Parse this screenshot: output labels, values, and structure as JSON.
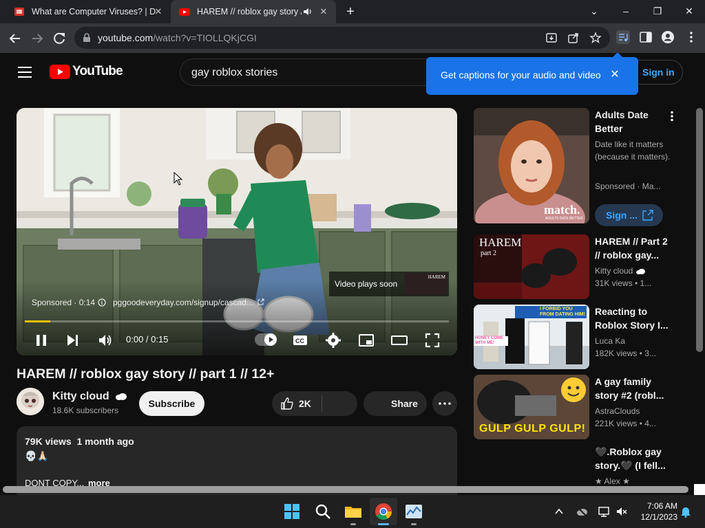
{
  "browser": {
    "tabs": [
      {
        "title": "What are Computer Viruses? | D",
        "active": false
      },
      {
        "title": "HAREM // roblox gay story /",
        "active": true
      }
    ],
    "url_host": "youtube.com",
    "url_path": "/watch?v=TIOLLQKjCGI"
  },
  "header": {
    "logo_text": "YouTube",
    "search_value": "gay roblox stories",
    "signin_label": "Sign in"
  },
  "tooltip": {
    "text": "Get captions for your audio and video"
  },
  "player": {
    "sponsored_label": "Sponsored · 0:14",
    "ad_url": "pggoodeveryday.com/signup/cascad...",
    "video_plays_soon": "Video plays soon",
    "up_next_thumb_text": "HAREM",
    "time": "0:00 / 0:15",
    "progress": 0.06
  },
  "video": {
    "title": "HAREM // roblox gay story // part 1 // 12+",
    "channel": "Kitty cloud",
    "subscribers": "18.6K subscribers",
    "subscribe_label": "Subscribe",
    "likes": "2K",
    "share_label": "Share",
    "views_date": "79K views  1 month ago",
    "desc_emoji": "💀🙏🏻",
    "desc_snippet": "DONT COPY...",
    "more_label": "more"
  },
  "sidebar": [
    {
      "title": "Adults Date Better",
      "line2": "Date like it matters (because it matters).",
      "meta": "Sponsored · Ma...",
      "cta": "Sign ...",
      "thumb_text": "match.",
      "thumb_sub": "ADULTS DATE BETTER"
    },
    {
      "title": "HAREM // Part 2 // roblox gay...",
      "channel": "Kitty cloud",
      "views": "31K views  • 1...",
      "thumb_text": "HAREM",
      "thumb_sub": "part 2"
    },
    {
      "title": "Reacting to Roblox Story I...",
      "channel": "Luca Ka",
      "views": "182K views  • 3...",
      "thumb_text": "I FORBID YOU FROM DATING HIM!",
      "thumb_sub": "HONEY COME WITH ME!"
    },
    {
      "title": "A gay family story #2 (robl...",
      "channel": "AstraClouds",
      "views": "221K views  • 4...",
      "thumb_text": "GULP GULP GULP!"
    },
    {
      "title": "🖤.Roblox gay story.🖤 (I fell...",
      "channel": "★ Alex ★"
    }
  ],
  "taskbar": {
    "time": "7:06 AM",
    "date": "12/1/2023"
  },
  "colors": {
    "accent_red": "#ff0000",
    "link_blue": "#3ea6ff",
    "tooltip_blue": "#1a73e8",
    "progress_yellow": "#f2c200"
  }
}
